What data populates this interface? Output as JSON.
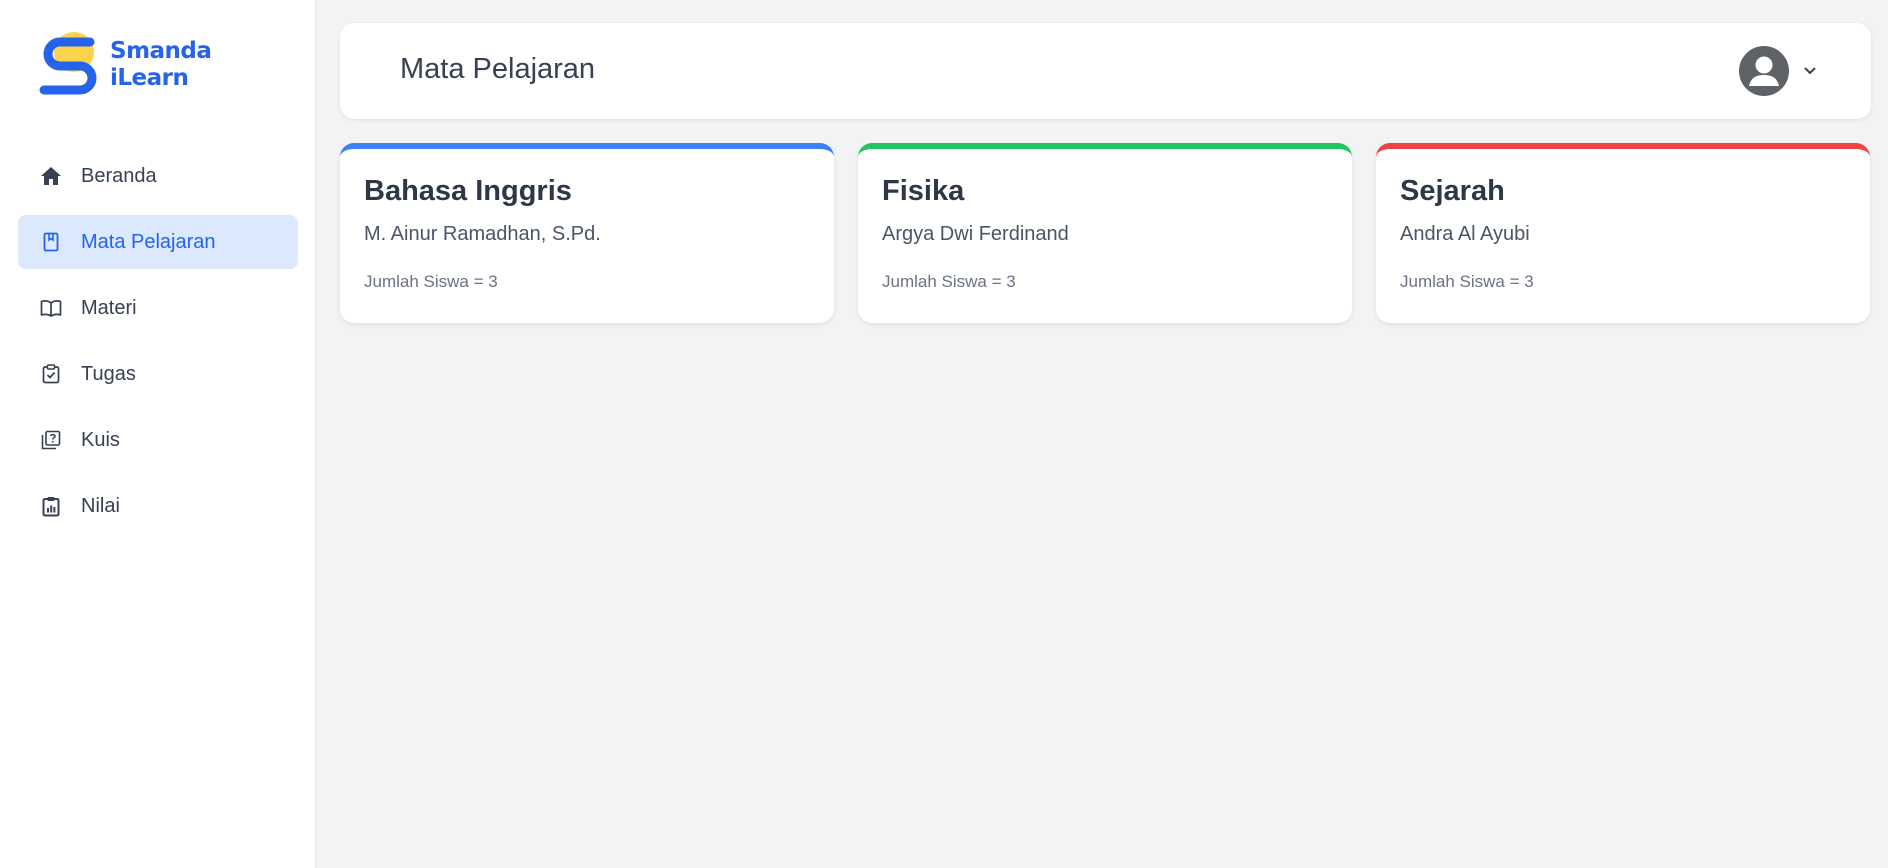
{
  "brand": {
    "line1": "Smanda",
    "line2": "iLearn",
    "color": "#2563eb",
    "accent": "#fcd34d"
  },
  "sidebar": {
    "items": [
      {
        "label": "Beranda",
        "icon": "home-icon",
        "active": false
      },
      {
        "label": "Mata Pelajaran",
        "icon": "book-icon",
        "active": true
      },
      {
        "label": "Materi",
        "icon": "open-book-icon",
        "active": false
      },
      {
        "label": "Tugas",
        "icon": "clipboard-check-icon",
        "active": false
      },
      {
        "label": "Kuis",
        "icon": "quiz-icon",
        "active": false
      },
      {
        "label": "Nilai",
        "icon": "clipboard-chart-icon",
        "active": false
      }
    ]
  },
  "header": {
    "title": "Mata Pelajaran",
    "user_icon": "user-avatar-icon",
    "menu_icon": "chevron-down-icon"
  },
  "courses": [
    {
      "title": "Bahasa Inggris",
      "teacher": "M. Ainur Ramadhan, S.Pd.",
      "students": "Jumlah Siswa = 3",
      "color": "#3b82f6"
    },
    {
      "title": "Fisika",
      "teacher": "Argya Dwi Ferdinand",
      "students": "Jumlah Siswa = 3",
      "color": "#22c55e"
    },
    {
      "title": "Sejarah",
      "teacher": "Andra Al Ayubi",
      "students": "Jumlah Siswa = 3",
      "color": "#ef4444"
    }
  ]
}
